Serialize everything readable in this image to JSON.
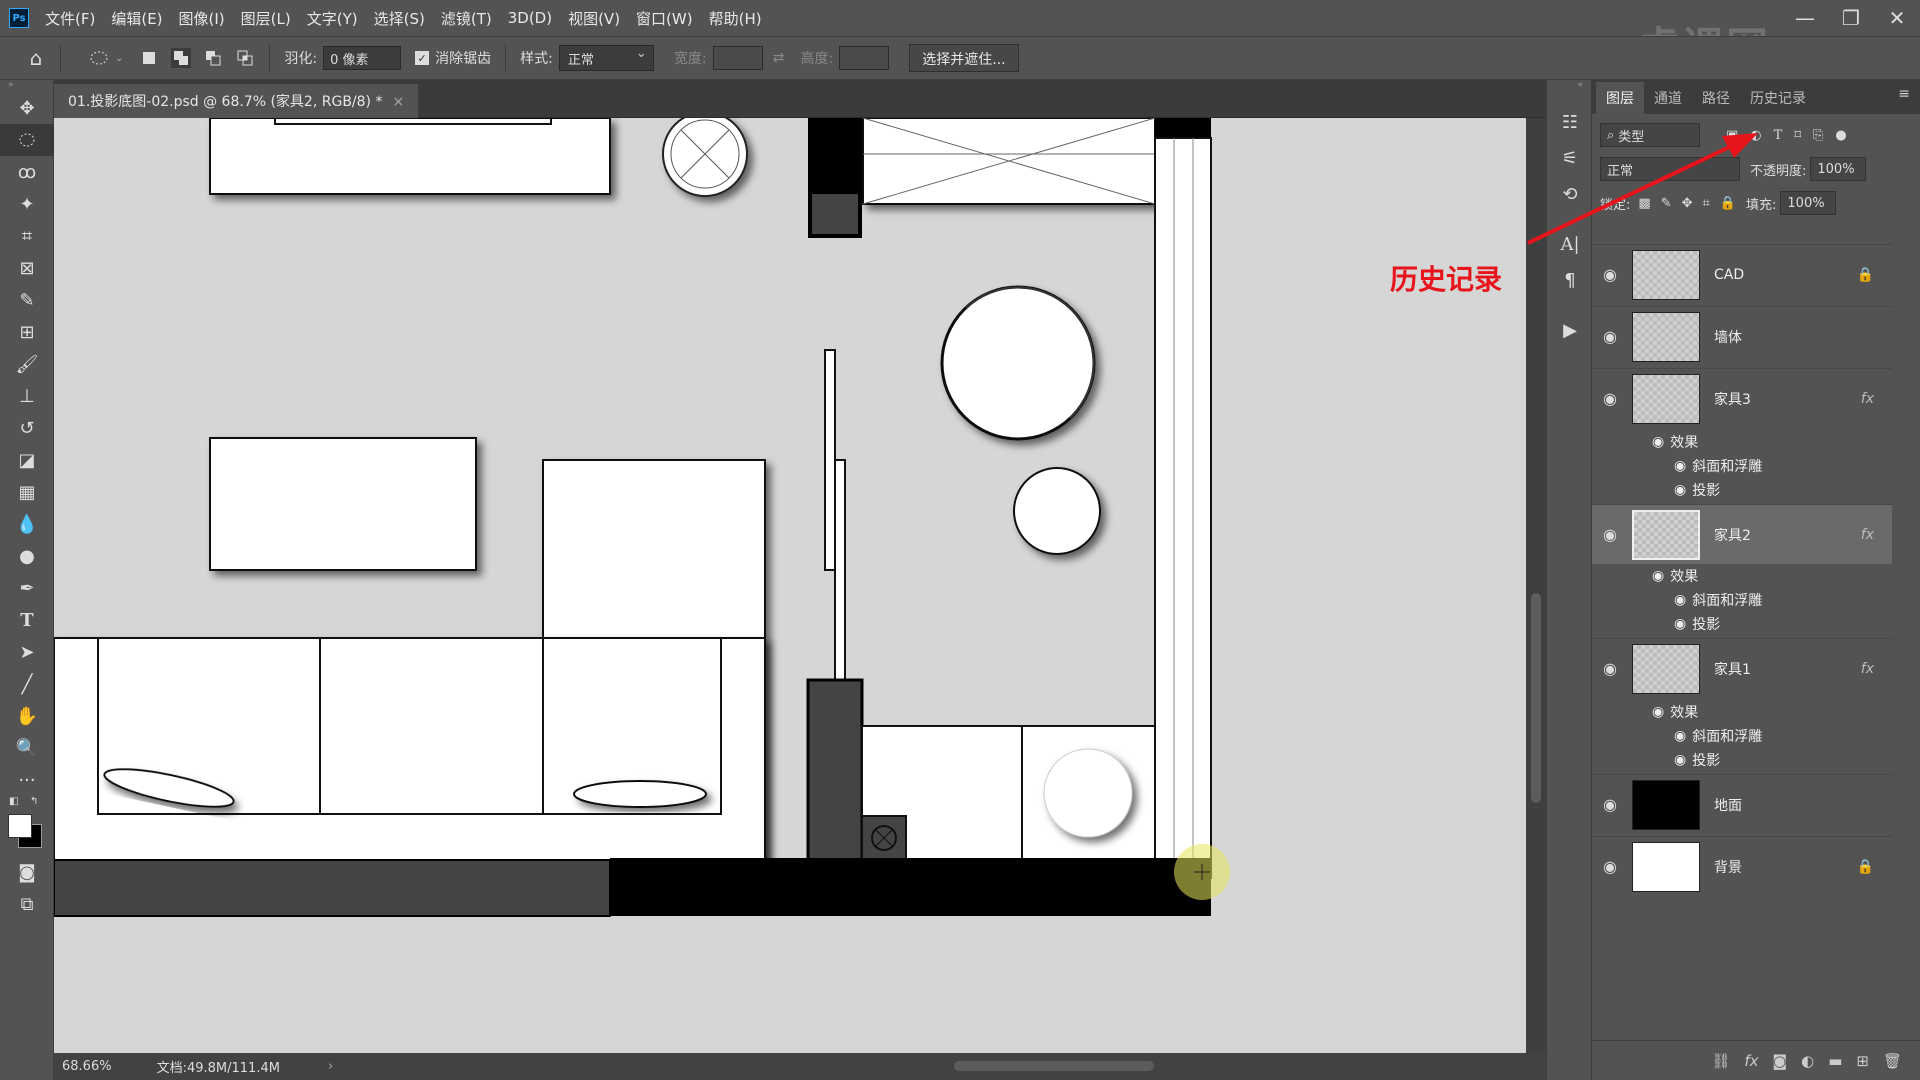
{
  "menubar": {
    "logo": "Ps",
    "items": [
      "文件(F)",
      "编辑(E)",
      "图像(I)",
      "图层(L)",
      "文字(Y)",
      "选择(S)",
      "滤镜(T)",
      "3D(D)",
      "视图(V)",
      "窗口(W)",
      "帮助(H)"
    ],
    "watermark": "虎课网"
  },
  "options": {
    "feather_label": "羽化:",
    "feather_value": "0 像素",
    "antialias_label": "消除锯齿",
    "style_label": "样式:",
    "style_value": "正常",
    "width_label": "宽度:",
    "height_label": "高度:",
    "select_mask_button": "选择并遮住..."
  },
  "document": {
    "tab_title": "01.投影底图-02.psd @ 68.7% (家具2, RGB/8) *",
    "close": "×"
  },
  "status": {
    "zoom": "68.66%",
    "doc_size": "文档:49.8M/111.4M",
    "arrow": "›"
  },
  "panel": {
    "tabs": [
      "图层",
      "通道",
      "路径",
      "历史记录"
    ],
    "filter_kind": "类型",
    "blend_mode": "正常",
    "opacity_label": "不透明度:",
    "opacity_value": "100%",
    "lock_label": "锁定:",
    "fill_label": "填充:",
    "fill_value": "100%"
  },
  "layers": [
    {
      "name": "CAD",
      "locked": true
    },
    {
      "name": "墙体"
    },
    {
      "name": "家具3",
      "fx": "fx"
    },
    {
      "name": "家具2",
      "fx": "fx",
      "selected": true
    },
    {
      "name": "家具1",
      "fx": "fx"
    },
    {
      "name": "地面"
    },
    {
      "name": "背景",
      "locked": true
    }
  ],
  "effects": {
    "effects_label": "效果",
    "bevel": "斜面和浮雕",
    "shadow": "投影"
  },
  "annotation": {
    "text": "历史记录",
    "color": "#e8141b"
  },
  "colors": {
    "canvas_bg": "#d6d6d6",
    "ui_bg": "#535353",
    "selected_layer": "#6a6a6a"
  }
}
